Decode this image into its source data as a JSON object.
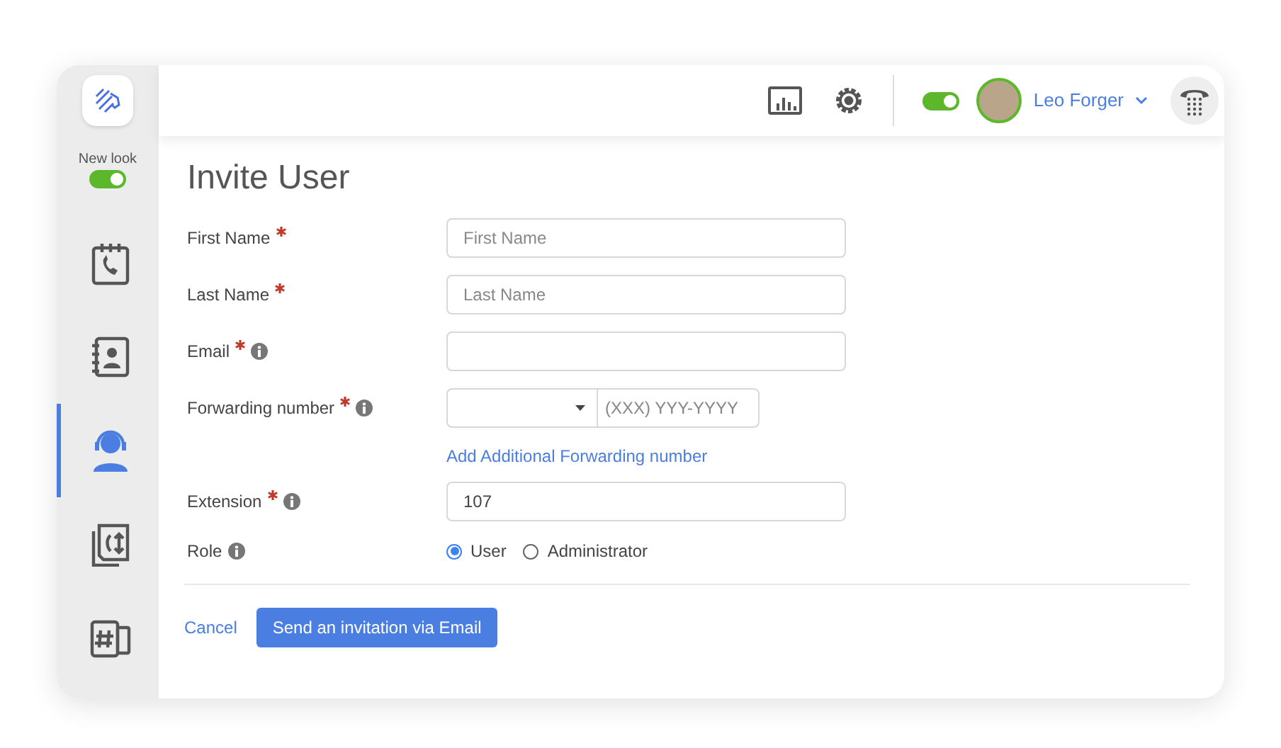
{
  "sidebar": {
    "new_look": {
      "label": "New look",
      "on": true
    },
    "items": [
      {
        "kind": "calendar",
        "selected": false
      },
      {
        "kind": "contacts",
        "selected": false
      },
      {
        "kind": "agent",
        "selected": true
      },
      {
        "kind": "routing",
        "selected": false
      },
      {
        "kind": "numbers",
        "selected": false
      }
    ]
  },
  "header": {
    "status_toggle": {
      "on": true
    },
    "user": {
      "name": "Leo Forger"
    }
  },
  "title": "Invite User",
  "fields": [
    {
      "kind": "text",
      "label": "First Name",
      "required": true,
      "info": false,
      "placeholder": "First Name"
    },
    {
      "kind": "text",
      "label": "Last Name",
      "required": true,
      "info": false,
      "placeholder": "Last Name"
    },
    {
      "kind": "text",
      "label": "Email",
      "required": true,
      "info": true
    },
    {
      "kind": "phone",
      "label": "Forwarding number",
      "required": true,
      "info": true,
      "placeholder": "(XXX) YYY-YYYY",
      "link": "Add Additional Forwarding number"
    },
    {
      "kind": "text",
      "label": "Extension",
      "required": true,
      "info": true,
      "value": "107"
    },
    {
      "kind": "radio",
      "label": "Role",
      "required": false,
      "info": true,
      "options": [
        {
          "label": "User",
          "selected": true
        },
        {
          "label": "Administrator",
          "selected": false
        }
      ]
    }
  ],
  "actions": {
    "cancel": "Cancel",
    "submit": "Send an invitation via Email"
  }
}
